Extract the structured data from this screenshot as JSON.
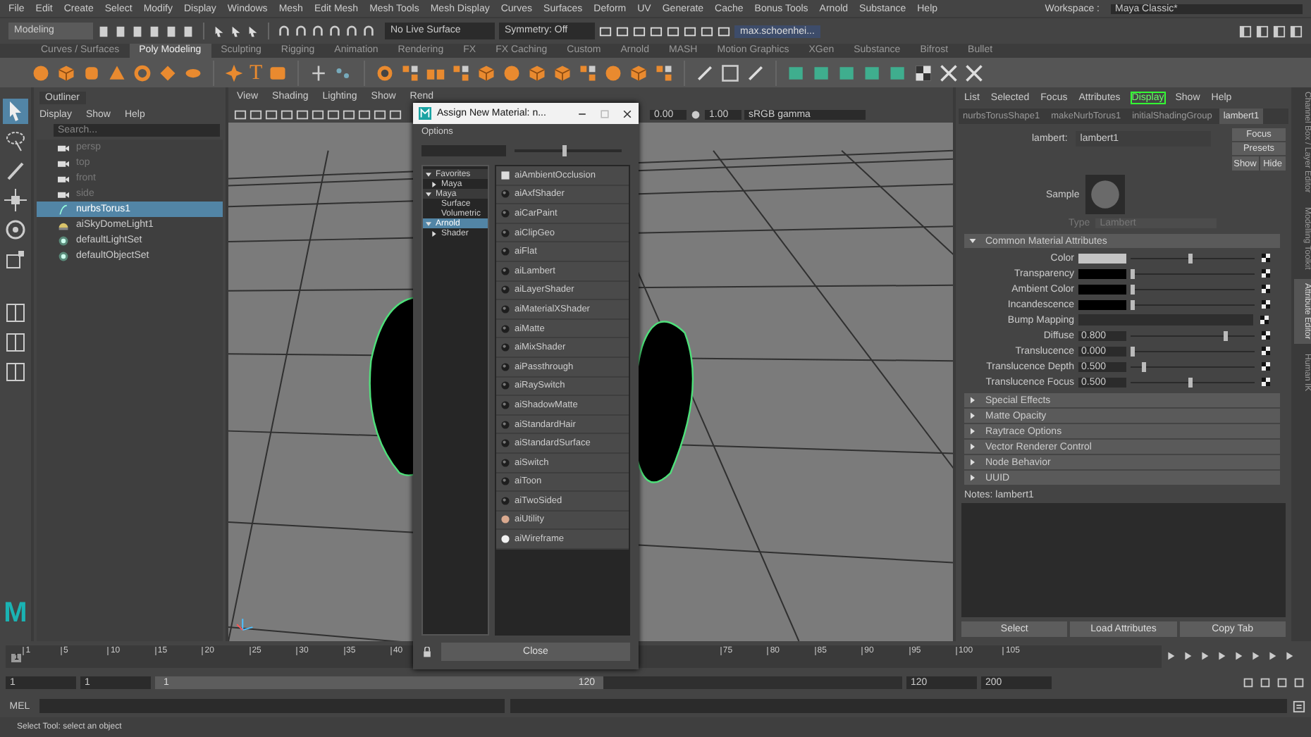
{
  "menu_bar": {
    "items": [
      "File",
      "Edit",
      "Create",
      "Select",
      "Modify",
      "Display",
      "Windows",
      "Mesh",
      "Edit Mesh",
      "Mesh Tools",
      "Mesh Display",
      "Curves",
      "Surfaces",
      "Deform",
      "UV",
      "Generate",
      "Cache",
      "Bonus Tools",
      "Arnold",
      "Substance",
      "Help"
    ],
    "workspace_label": "Workspace :",
    "workspace": "Maya Classic*"
  },
  "status_line": {
    "mode": "Modeling",
    "live_surface": "No Live Surface",
    "symmetry": "Symmetry: Off",
    "user": "max.schoenhei..."
  },
  "shelf_tabs": [
    {
      "label": "Curves / Surfaces",
      "selected": false
    },
    {
      "label": "Poly Modeling",
      "selected": true
    },
    {
      "label": "Sculpting",
      "selected": false
    },
    {
      "label": "Rigging",
      "selected": false
    },
    {
      "label": "Animation",
      "selected": false
    },
    {
      "label": "Rendering",
      "selected": false
    },
    {
      "label": "FX",
      "selected": false
    },
    {
      "label": "FX Caching",
      "selected": false
    },
    {
      "label": "Custom",
      "selected": false
    },
    {
      "label": "Arnold",
      "selected": false
    },
    {
      "label": "MASH",
      "selected": false
    },
    {
      "label": "Motion Graphics",
      "selected": false
    },
    {
      "label": "XGen",
      "selected": false
    },
    {
      "label": "Substance",
      "selected": false
    },
    {
      "label": "Bifrost",
      "selected": false
    },
    {
      "label": "Bullet",
      "selected": false
    }
  ],
  "shelf_text_icon": "T",
  "logo": "M",
  "outliner": {
    "title": "Outliner",
    "menu": [
      "Display",
      "Show",
      "Help"
    ],
    "search_placeholder": "Search...",
    "items": [
      {
        "label": "persp",
        "kind": "camera",
        "dimmed": true,
        "selected": false
      },
      {
        "label": "top",
        "kind": "camera",
        "dimmed": true,
        "selected": false
      },
      {
        "label": "front",
        "kind": "camera",
        "dimmed": true,
        "selected": false
      },
      {
        "label": "side",
        "kind": "camera",
        "dimmed": true,
        "selected": false
      },
      {
        "label": "nurbsTorus1",
        "kind": "curve",
        "dimmed": false,
        "selected": true
      },
      {
        "label": "aiSkyDomeLight1",
        "kind": "light",
        "dimmed": false,
        "selected": false
      },
      {
        "label": "defaultLightSet",
        "kind": "set",
        "dimmed": false,
        "selected": false
      },
      {
        "label": "defaultObjectSet",
        "kind": "set",
        "dimmed": false,
        "selected": false
      }
    ]
  },
  "viewport": {
    "menu": [
      "View",
      "Shading",
      "Lighting",
      "Show",
      "Rend"
    ],
    "exposure": "0.00",
    "gamma": "1.00",
    "color_space": "sRGB gamma"
  },
  "dialog": {
    "title": "Assign New Material: n...",
    "menu": "Options",
    "slider": {
      "level": 0.45
    },
    "tree": [
      {
        "label": "Favorites",
        "expanded": true,
        "selected": false,
        "children": [
          {
            "label": "Maya",
            "expanded": false,
            "selected": false
          }
        ]
      },
      {
        "label": "Maya",
        "expanded": true,
        "selected": false,
        "children": [
          {
            "label": "Surface",
            "selected": false
          },
          {
            "label": "Volumetric",
            "selected": false
          }
        ]
      },
      {
        "label": "Arnold",
        "expanded": true,
        "selected": true,
        "children": [
          {
            "label": "Shader",
            "expanded": false,
            "selected": false
          }
        ]
      }
    ],
    "materials": [
      {
        "label": "aiAmbientOcclusion",
        "kind": "square"
      },
      {
        "label": "aiAxfShader",
        "kind": "ball"
      },
      {
        "label": "aiCarPaint",
        "kind": "ball"
      },
      {
        "label": "aiClipGeo",
        "kind": "ball"
      },
      {
        "label": "aiFlat",
        "kind": "ball"
      },
      {
        "label": "aiLambert",
        "kind": "ball"
      },
      {
        "label": "aiLayerShader",
        "kind": "ball"
      },
      {
        "label": "aiMaterialXShader",
        "kind": "ball"
      },
      {
        "label": "aiMatte",
        "kind": "ball"
      },
      {
        "label": "aiMixShader",
        "kind": "ball"
      },
      {
        "label": "aiPassthrough",
        "kind": "ball"
      },
      {
        "label": "aiRaySwitch",
        "kind": "ball"
      },
      {
        "label": "aiShadowMatte",
        "kind": "ball"
      },
      {
        "label": "aiStandardHair",
        "kind": "ball"
      },
      {
        "label": "aiStandardSurface",
        "kind": "ball"
      },
      {
        "label": "aiSwitch",
        "kind": "ball"
      },
      {
        "label": "aiToon",
        "kind": "ball"
      },
      {
        "label": "aiTwoSided",
        "kind": "ball"
      },
      {
        "label": "aiUtility",
        "kind": "orange"
      },
      {
        "label": "aiWireframe",
        "kind": "white"
      }
    ],
    "close": "Close"
  },
  "attribute_editor": {
    "menu": [
      {
        "label": "List",
        "selected": false
      },
      {
        "label": "Selected",
        "selected": false
      },
      {
        "label": "Focus",
        "selected": false
      },
      {
        "label": "Attributes",
        "selected": false
      },
      {
        "label": "Display",
        "selected": true
      },
      {
        "label": "Show",
        "selected": false
      },
      {
        "label": "Help",
        "selected": false
      }
    ],
    "tabs": [
      {
        "label": "nurbsTorusShape1",
        "selected": false
      },
      {
        "label": "makeNurbTorus1",
        "selected": false
      },
      {
        "label": "initialShadingGroup",
        "selected": false
      },
      {
        "label": "lambert1",
        "selected": true
      }
    ],
    "node_label": "lambert:",
    "node_name": "lambert1",
    "side_buttons": [
      "Focus",
      "Presets"
    ],
    "show": "Show",
    "hide": "Hide",
    "sample_label": "Sample",
    "type_label": "Type",
    "type_value": "Lambert",
    "common_section": {
      "label": "Common Material Attributes",
      "expanded": true
    },
    "attributes": [
      {
        "label": "Color",
        "kind": "color",
        "color": "#c4c4c4",
        "level": 0.5
      },
      {
        "label": "Transparency",
        "kind": "color",
        "color": "#000000",
        "level": 0
      },
      {
        "label": "Ambient Color",
        "kind": "color",
        "color": "#000000",
        "level": 0
      },
      {
        "label": "Incandescence",
        "kind": "color",
        "color": "#000000",
        "level": 0
      },
      {
        "label": "Bump Mapping",
        "kind": "map"
      },
      {
        "label": "Diffuse",
        "kind": "number",
        "value": "0.800",
        "level": 0.8
      },
      {
        "label": "Translucence",
        "kind": "number",
        "value": "0.000",
        "level": 0
      },
      {
        "label": "Translucence Depth",
        "kind": "number",
        "value": "0.500",
        "level": 0.1
      },
      {
        "label": "Translucence Focus",
        "kind": "number",
        "value": "0.500",
        "level": 0.5
      }
    ],
    "sections": [
      {
        "label": "Special Effects",
        "expanded": false
      },
      {
        "label": "Matte Opacity",
        "expanded": false
      },
      {
        "label": "Raytrace Options",
        "expanded": false
      },
      {
        "label": "Vector Renderer Control",
        "expanded": false
      },
      {
        "label": "Node Behavior",
        "expanded": false
      },
      {
        "label": "UUID",
        "expanded": false
      }
    ],
    "notes": "Notes:  lambert1",
    "bottom_buttons": [
      "Select",
      "Load Attributes",
      "Copy Tab"
    ]
  },
  "side_tabs": [
    {
      "label": "Channel Box / Layer Editor",
      "selected": false
    },
    {
      "label": "Modelling Toolkit",
      "selected": false
    },
    {
      "label": "Attribute Editor",
      "selected": true
    },
    {
      "label": "Human IK",
      "selected": false
    }
  ],
  "timeline": {
    "ticks": [
      "1",
      "5",
      "10",
      "15",
      "20",
      "25",
      "30",
      "35",
      "40",
      "75",
      "80",
      "85",
      "90",
      "95",
      "100",
      "105"
    ],
    "current": "1",
    "level": 0
  },
  "range": {
    "start": "1",
    "anim_start": "1",
    "slider_start": "1",
    "slider_end": "120",
    "anim_end": "120",
    "end": "200",
    "level": 0.6
  },
  "command_line": {
    "label": "MEL"
  },
  "help_line": "Select Tool: select an object"
}
